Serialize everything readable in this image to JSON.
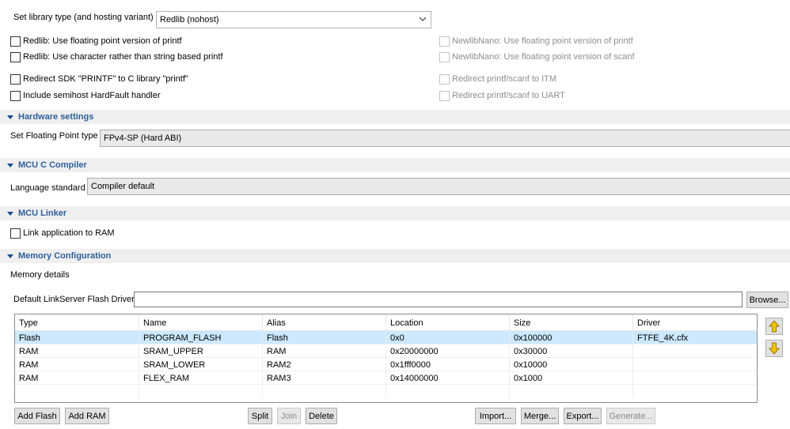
{
  "library": {
    "label": "Set library type (and hosting variant)",
    "selected": "Redlib (nohost)"
  },
  "checkboxes_left": [
    {
      "label": "Redlib: Use floating point version of printf",
      "checked": false
    },
    {
      "label": "Redlib: Use character rather than string based printf",
      "checked": false
    },
    {
      "label": "Redirect SDK \"PRINTF\" to C library \"printf\"",
      "checked": false
    },
    {
      "label": "Include semihost HardFault handler",
      "checked": false
    }
  ],
  "checkboxes_right": [
    {
      "label": "NewlibNano: Use floating point version of printf",
      "checked": false,
      "disabled": true
    },
    {
      "label": "NewlibNano: Use floating point version of scanf",
      "checked": false,
      "disabled": true
    },
    {
      "label": "Redirect printf/scanf to ITM",
      "checked": false,
      "disabled": true
    },
    {
      "label": "Redirect printf/scanf to UART",
      "checked": false,
      "disabled": true
    }
  ],
  "hardware": {
    "section_title": "Hardware settings",
    "fp_label": "Set Floating Point type",
    "fp_value": "FPv4-SP (Hard ABI)"
  },
  "compiler": {
    "section_title": "MCU C Compiler",
    "lang_label": "Language standard",
    "lang_value": "Compiler default"
  },
  "linker": {
    "section_title": "MCU Linker",
    "link_ram_label": "Link application to RAM"
  },
  "memory": {
    "section_title": "Memory Configuration",
    "details_label": "Memory details",
    "flash_driver_label": "Default LinkServer Flash Driver",
    "flash_driver_value": "",
    "browse_label": "Browse...",
    "columns": [
      "Type",
      "Name",
      "Alias",
      "Location",
      "Size",
      "Driver"
    ],
    "rows": [
      [
        "Flash",
        "PROGRAM_FLASH",
        "Flash",
        "0x0",
        "0x100000",
        "FTFE_4K.cfx"
      ],
      [
        "RAM",
        "SRAM_UPPER",
        "RAM",
        "0x20000000",
        "0x30000",
        ""
      ],
      [
        "RAM",
        "SRAM_LOWER",
        "RAM2",
        "0x1fff0000",
        "0x10000",
        ""
      ],
      [
        "RAM",
        "FLEX_RAM",
        "RAM3",
        "0x14000000",
        "0x1000",
        ""
      ]
    ],
    "buttons": {
      "add_flash": "Add Flash",
      "add_ram": "Add RAM",
      "split": "Split",
      "join": "Join",
      "delete": "Delete",
      "import": "Import...",
      "merge": "Merge...",
      "export": "Export...",
      "generate": "Generate..."
    }
  },
  "colors": {
    "section_title": "#2e5f9a",
    "selected_row": "#cce8ff",
    "arrow_icon": "#d4a017"
  }
}
